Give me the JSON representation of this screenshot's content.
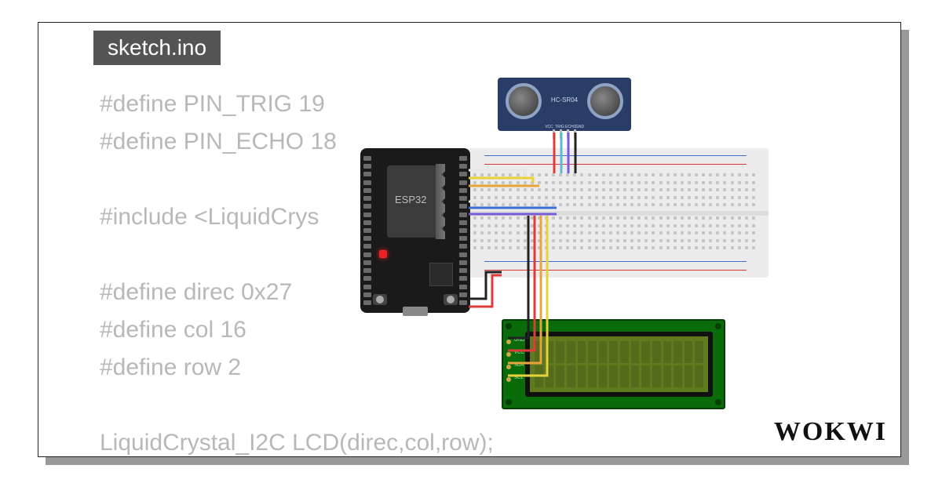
{
  "tab": {
    "filename": "sketch.ino"
  },
  "code": {
    "line1": "#define PIN_TRIG 19",
    "line2": "#define PIN_ECHO 18",
    "line3": "",
    "line4": "#include <LiquidCrys",
    "line5": "",
    "line6": "#define direc 0x27",
    "line7": "#define col 16",
    "line8": "#define row 2",
    "line9": "",
    "line10": "LiquidCrystal_I2C LCD(direc,col,row);"
  },
  "logo": {
    "text": "WOKWI"
  },
  "components": {
    "sensor": {
      "model": "HC-SR04",
      "pins": [
        "VCC",
        "TRIG",
        "ECHO",
        "GND"
      ]
    },
    "mcu": {
      "label": "ESP32"
    },
    "lcd": {
      "pins": [
        "GND",
        "VCC",
        "SDA",
        "SCL"
      ],
      "cols": 16,
      "rows": 2
    }
  },
  "wires": {
    "colors": {
      "red": "#e03b3b",
      "black": "#222",
      "orange": "#e8a33a",
      "yellow": "#e8d23a",
      "blue": "#3b6fd6",
      "violet": "#7a5bd6",
      "cyan": "#5fb7d6",
      "white": "#e8e8e8"
    }
  }
}
